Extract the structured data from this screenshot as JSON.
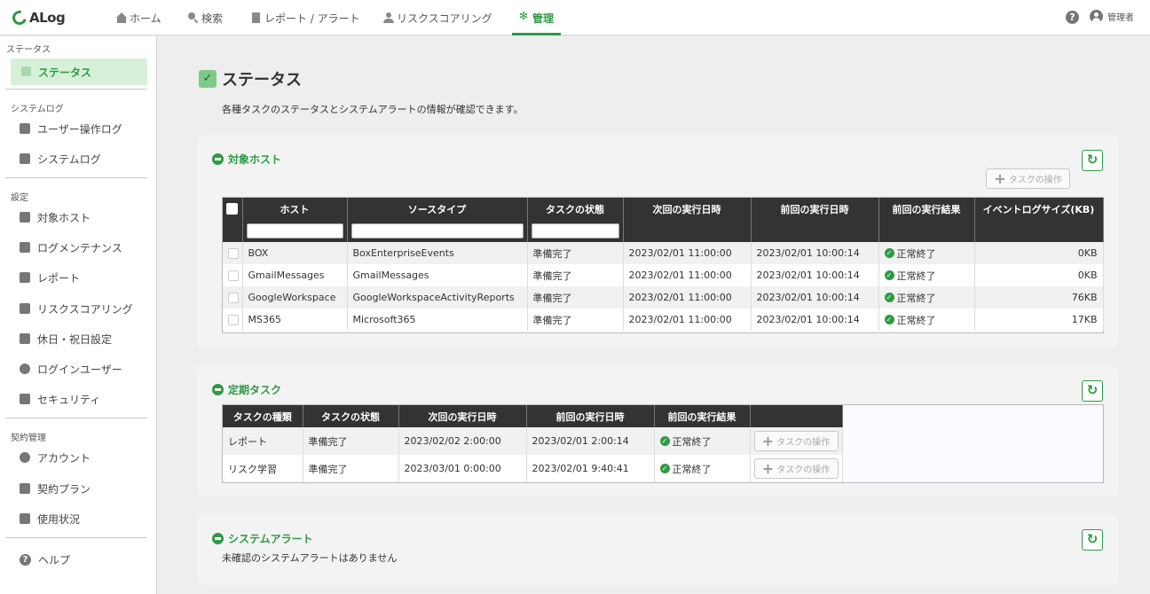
{
  "app": {
    "logo_text": "ALog"
  },
  "topnav": {
    "items": [
      {
        "label": "ホーム",
        "icon": "home-icon"
      },
      {
        "label": "検索",
        "icon": "search-icon"
      },
      {
        "label": "レポート / アラート",
        "icon": "document-icon"
      },
      {
        "label": "リスクスコアリング",
        "icon": "users-icon"
      },
      {
        "label": "管理",
        "icon": "gear-icon",
        "active": true
      }
    ],
    "user_label": "管理者"
  },
  "sidebar": {
    "sections": [
      {
        "title": "ステータス"
      },
      {
        "title": "システムログ"
      },
      {
        "title": "設定"
      },
      {
        "title": "契約管理"
      }
    ],
    "active_item": "ステータス",
    "items": [
      {
        "label": "ユーザー操作ログ"
      },
      {
        "label": "システムログ"
      },
      {
        "label": "対象ホスト"
      },
      {
        "label": "ログメンテナンス"
      },
      {
        "label": "レポート"
      },
      {
        "label": "リスクスコアリング"
      },
      {
        "label": "休日・祝日設定"
      },
      {
        "label": "ログインユーザー"
      },
      {
        "label": "セキュリティ"
      },
      {
        "label": "アカウント"
      },
      {
        "label": "契約プラン"
      },
      {
        "label": "使用状況"
      }
    ],
    "help_label": "ヘルプ"
  },
  "main": {
    "title": "ステータス",
    "description": "各種タスクのステータスとシステムアラートの情報が確認できます。"
  },
  "hosts_panel": {
    "title": "対象ホスト",
    "task_op_label": "タスクの操作",
    "columns": [
      "ホスト",
      "ソースタイプ",
      "タスクの状態",
      "次回の実行日時",
      "前回の実行日時",
      "前回の実行結果",
      "イベントログサイズ(KB)"
    ],
    "rows": [
      {
        "host": "BOX",
        "source": "BoxEnterpriseEvents",
        "state": "準備完了",
        "next": "2023/02/01 11:00:00",
        "prev": "2023/02/01 10:00:14",
        "result": "正常終了",
        "size": "0KB"
      },
      {
        "host": "GmailMessages",
        "source": "GmailMessages",
        "state": "準備完了",
        "next": "2023/02/01 11:00:00",
        "prev": "2023/02/01 10:00:14",
        "result": "正常終了",
        "size": "0KB"
      },
      {
        "host": "GoogleWorkspace",
        "source": "GoogleWorkspaceActivityReports",
        "state": "準備完了",
        "next": "2023/02/01 11:00:00",
        "prev": "2023/02/01 10:00:14",
        "result": "正常終了",
        "size": "76KB"
      },
      {
        "host": "MS365",
        "source": "Microsoft365",
        "state": "準備完了",
        "next": "2023/02/01 11:00:00",
        "prev": "2023/02/01 10:00:14",
        "result": "正常終了",
        "size": "17KB"
      }
    ]
  },
  "tasks_panel": {
    "title": "定期タスク",
    "columns": [
      "タスクの種類",
      "タスクの状態",
      "次回の実行日時",
      "前回の実行日時",
      "前回の実行結果",
      ""
    ],
    "rows": [
      {
        "type": "レポート",
        "state": "準備完了",
        "next": "2023/02/02 2:00:00",
        "prev": "2023/02/01 2:00:14",
        "result": "正常終了",
        "op": "タスクの操作"
      },
      {
        "type": "リスク学習",
        "state": "準備完了",
        "next": "2023/03/01 0:00:00",
        "prev": "2023/02/01 9:40:41",
        "result": "正常終了",
        "op": "タスクの操作"
      }
    ]
  },
  "alerts_panel": {
    "title": "システムアラート",
    "message": "未確認のシステムアラートはありません"
  },
  "colors": {
    "accent": "#2e9a44",
    "header_bg": "#333333",
    "active_bg": "#d7f0d9"
  }
}
